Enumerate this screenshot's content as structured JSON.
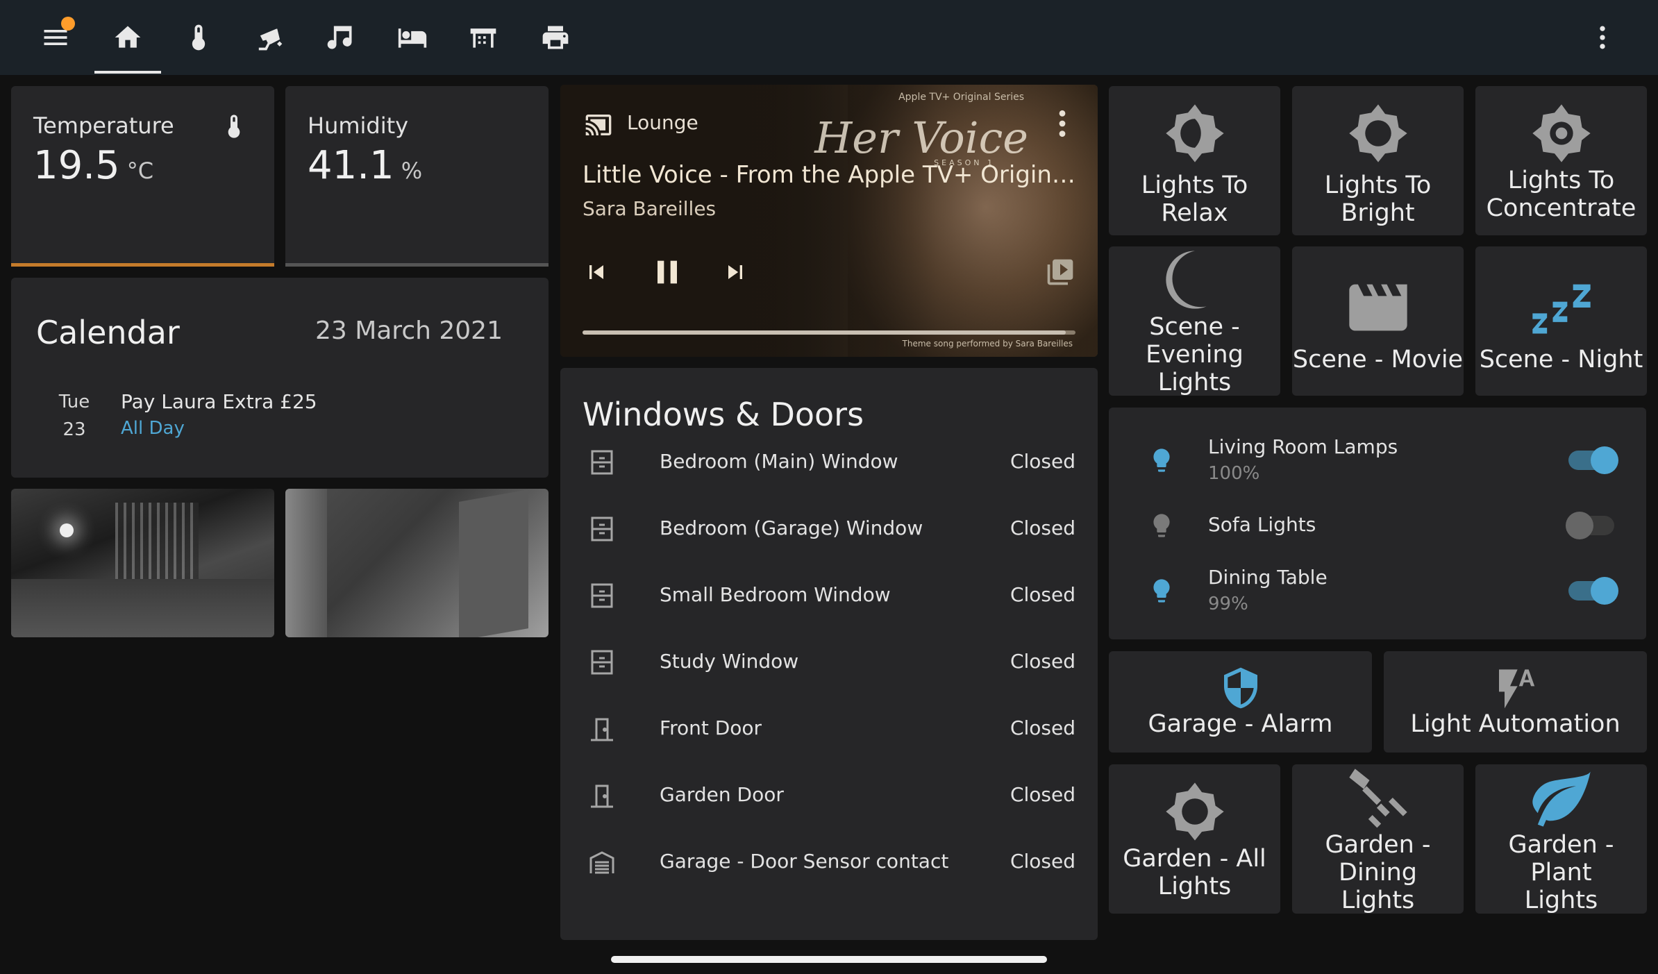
{
  "topbar": {
    "tabs": [
      "menu",
      "home",
      "climate",
      "security",
      "music",
      "bedroom",
      "garage",
      "printer"
    ],
    "overflow": "more-vertical"
  },
  "sensors": {
    "temperature": {
      "name": "Temperature",
      "value": "19.5",
      "unit": "°C",
      "bar_color": "#c47b2b"
    },
    "humidity": {
      "name": "Humidity",
      "value": "41.1",
      "unit": "%",
      "bar_color": "#555555"
    }
  },
  "calendar": {
    "title": "Calendar",
    "date": "23 March 2021",
    "event": {
      "weekday": "Tue",
      "day": "23",
      "title": "Pay Laura Extra £25",
      "time": "All Day"
    }
  },
  "media": {
    "source": "Lounge",
    "title": "Little Voice - From the Apple TV+ Original Series \"Little Voice\"",
    "artist": "Sara Bareilles",
    "progress": 0.98,
    "art_series_label": "Apple TV+ Original Series",
    "art_title": "Her Voice",
    "art_season": "SEASON 1",
    "art_credit": "Theme song performed by Sara Bareilles"
  },
  "windows_doors": {
    "title": "Windows & Doors",
    "items": [
      {
        "name": "Bedroom (Main) Window",
        "state": "Closed",
        "icon": "window"
      },
      {
        "name": "Bedroom (Garage) Window",
        "state": "Closed",
        "icon": "window"
      },
      {
        "name": "Small Bedroom Window",
        "state": "Closed",
        "icon": "window"
      },
      {
        "name": "Study Window",
        "state": "Closed",
        "icon": "window"
      },
      {
        "name": "Front Door",
        "state": "Closed",
        "icon": "door"
      },
      {
        "name": "Garden Door",
        "state": "Closed",
        "icon": "door"
      },
      {
        "name": "Garage - Door Sensor contact",
        "state": "Closed",
        "icon": "garage"
      }
    ]
  },
  "scenes": {
    "relax": "Lights To Relax",
    "bright": "Lights To Bright",
    "concentrate_1": "Lights To",
    "concentrate_2": "Concentrate",
    "evening_1": "Scene - Evening",
    "evening_2": "Lights",
    "movie": "Scene - Movie",
    "night": "Scene - Night"
  },
  "lights": [
    {
      "name": "Living Room Lamps",
      "brightness": "100%",
      "on": true
    },
    {
      "name": "Sofa Lights",
      "brightness": "",
      "on": false
    },
    {
      "name": "Dining Table",
      "brightness": "99%",
      "on": true
    }
  ],
  "automations": {
    "garage_alarm": "Garage - Alarm",
    "light_automation": "Light Automation"
  },
  "garden": {
    "all_1": "Garden - All",
    "all_2": "Lights",
    "dining_1": "Garden - Dining",
    "dining_2": "Lights",
    "plant_1": "Garden - Plant",
    "plant_2": "Lights"
  },
  "colors": {
    "accent": "#4fa7d4",
    "icon_gray": "#9e9e9e",
    "card": "#262628"
  }
}
